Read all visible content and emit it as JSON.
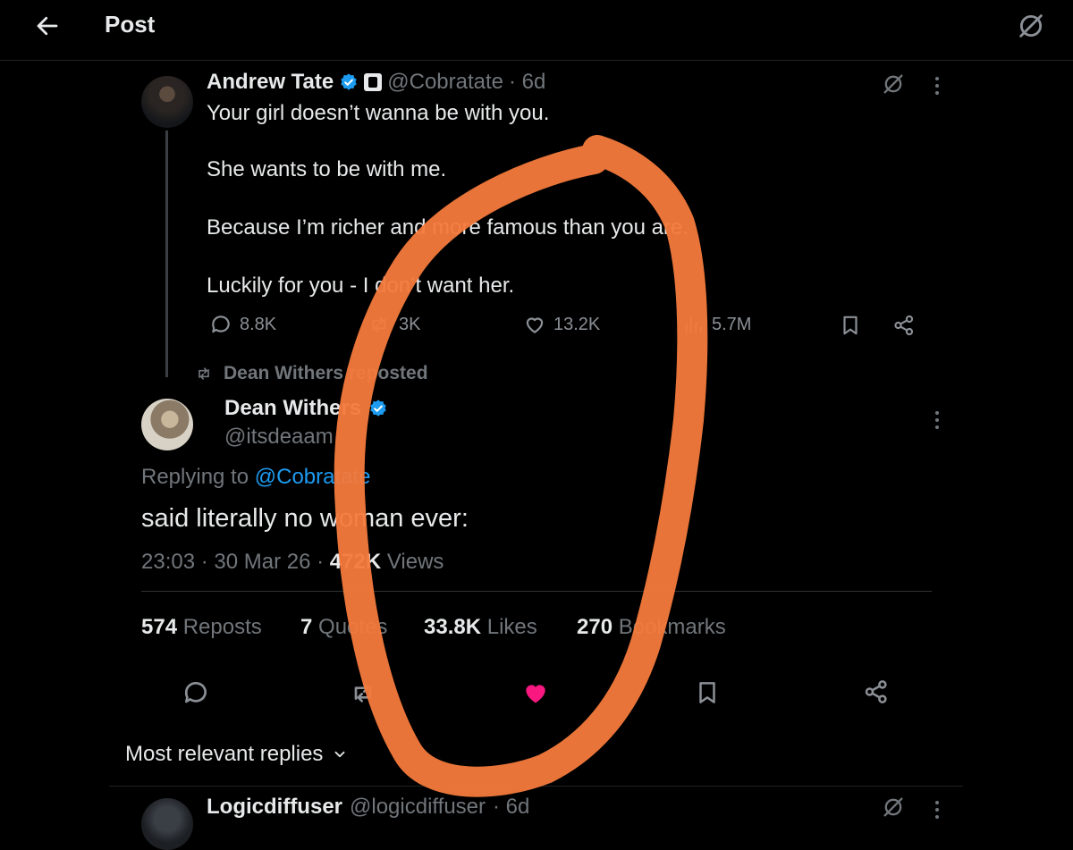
{
  "header": {
    "title": "Post",
    "back_icon": "arrow-left-icon",
    "grok_icon": "grok-icon"
  },
  "quoted_tweet": {
    "name": "Andrew Tate",
    "handle": "@Cobratate",
    "time": "· 6d",
    "lines": [
      "Your girl doesn’t wanna be with you.",
      "She wants to be with me.",
      "Because I’m richer and more famous than you are.",
      "Luckily for you - I don’t want her."
    ],
    "replies": "8.8K",
    "reposts": "3K",
    "likes": "13.2K",
    "views": "5.7M"
  },
  "repost_label": "Dean Withers reposted",
  "main_tweet": {
    "name": "Dean Withers",
    "handle": "@itsdeaam",
    "replying_prefix": "Replying to",
    "replying_to": "@Cobratate",
    "text": "said literally no woman ever:",
    "time": "23:03",
    "date": "30 Mar 26",
    "views_count": "472K",
    "views_label": "Views",
    "stats": {
      "reposts": {
        "count": "574",
        "label": "Reposts"
      },
      "quotes": {
        "count": "7",
        "label": "Quotes"
      },
      "likes": {
        "count": "33.8K",
        "label": "Likes"
      },
      "bookmarks": {
        "count": "270",
        "label": "Bookmarks"
      }
    },
    "liked": true
  },
  "sort_label": "Most relevant replies",
  "reply": {
    "name": "Logicdiffuser",
    "handle": "@logicdiffuser",
    "time": "· 6d"
  },
  "colors": {
    "background": "#000000",
    "text": "#e7e9ea",
    "muted": "#71767b",
    "link": "#1d9bf0",
    "verified": "#1d9bf0",
    "like_active": "#f91880",
    "annotation": "#f47a3c"
  }
}
